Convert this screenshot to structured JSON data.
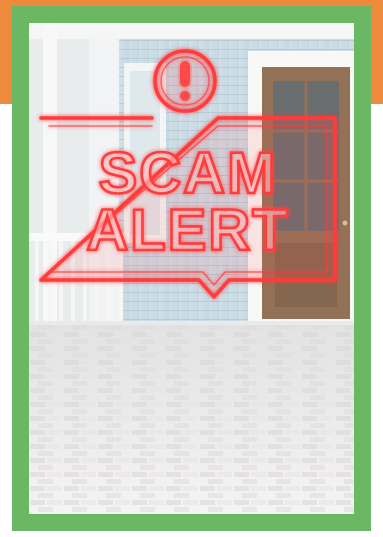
{
  "graphic": {
    "sign_text_line1": "SCAM",
    "sign_text_line2": "ALERT",
    "icon": "exclamation-circle-icon",
    "colors": {
      "frame_green": "#6ab764",
      "band_orange": "#ee8a3c",
      "neon_red": "#ff3b3b",
      "wall_blue": "#b9cfdc",
      "door_wood": "#7a5232"
    }
  }
}
